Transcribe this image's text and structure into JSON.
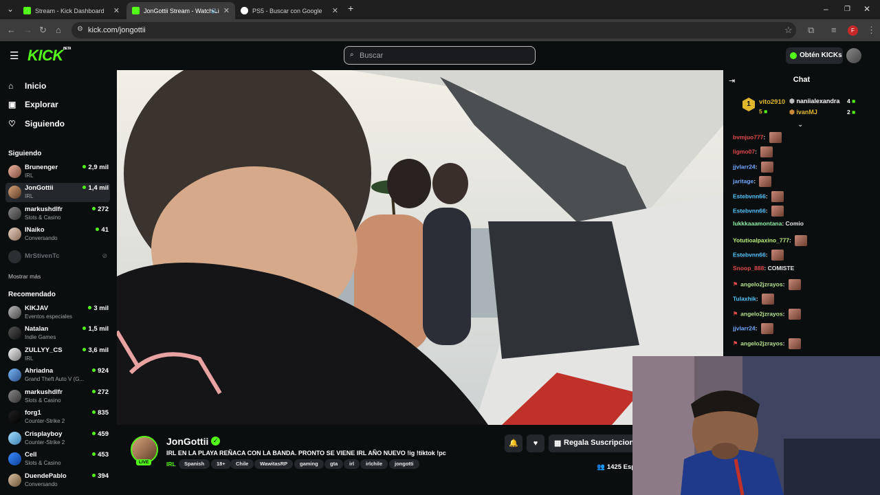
{
  "browser": {
    "tabs": [
      {
        "label": "Stream - Kick Dashboard",
        "active": false
      },
      {
        "label": "JonGottii Stream - Watch Li",
        "active": true
      },
      {
        "label": "PS5 - Buscar con Google",
        "active": false
      }
    ],
    "url": "kick.com/jongottii",
    "profile_initial": "F"
  },
  "header": {
    "logo": "KICK",
    "logo_sup": "BETA",
    "search_placeholder": "Buscar",
    "obten_label": "Obtén KICKs"
  },
  "sidebar": {
    "nav": [
      {
        "label": "Inicio",
        "icon": "home-icon"
      },
      {
        "label": "Explorar",
        "icon": "compass-icon"
      },
      {
        "label": "Siguiendo",
        "icon": "heart-icon"
      }
    ],
    "following_title": "Siguiendo",
    "following": [
      {
        "name": "Brunenger",
        "category": "IRL",
        "viewers": "2,9 mil"
      },
      {
        "name": "JonGottii",
        "category": "IRL",
        "viewers": "1,4 mil"
      },
      {
        "name": "markushdlfr",
        "category": "Slots & Casino",
        "viewers": "272"
      },
      {
        "name": "INaiko",
        "category": "Conversando",
        "viewers": "41"
      },
      {
        "name": "MrStivenTc",
        "category": "",
        "viewers": ""
      }
    ],
    "show_more": "Mostrar más",
    "recommended_title": "Recomendado",
    "recommended": [
      {
        "name": "KIKJAV",
        "category": "Eventos especiales",
        "viewers": "3 mil"
      },
      {
        "name": "Natalan",
        "category": "Indie Games",
        "viewers": "1,5 mil"
      },
      {
        "name": "ZULLYY_CS",
        "category": "IRL",
        "viewers": "3,6 mil"
      },
      {
        "name": "Ahriadna",
        "category": "Grand Theft Auto V (G...",
        "viewers": "924"
      },
      {
        "name": "markushdlfr",
        "category": "Slots & Casino",
        "viewers": "272"
      },
      {
        "name": "forg1",
        "category": "Counter-Strike 2",
        "viewers": "835"
      },
      {
        "name": "Crisplayboy",
        "category": "Counter-Strike 2",
        "viewers": "459"
      },
      {
        "name": "Cell",
        "category": "Slots & Casino",
        "viewers": "453"
      },
      {
        "name": "DuendePablo",
        "category": "Conversando",
        "viewers": "394"
      }
    ]
  },
  "stream": {
    "channel": "JonGottii",
    "live_label": "LIVE",
    "title": "IRL EN LA PLAYA REÑACA CON LA BANDA. PRONTO SE VIENE IRL AÑO NUEVO !ig !tiktok !pc",
    "category": "IRL",
    "tags": [
      "Spanish",
      "18+",
      "Chile",
      "WawitasRP",
      "gaming",
      "gta",
      "irl",
      "irlchile",
      "jongotti"
    ],
    "gift_label": "Regala Suscripcione",
    "viewers": "1425 Esp"
  },
  "chat": {
    "title": "Chat",
    "gifters": [
      {
        "name": "vito2910",
        "count": "5",
        "rank": "1"
      },
      {
        "name": "naniialexandra",
        "count": "4"
      },
      {
        "name": "ivanMJ",
        "count": "2"
      }
    ],
    "messages": [
      {
        "user": "bvmjuo777",
        "text": "",
        "color": "#e24a4a",
        "emote": true
      },
      {
        "user": "ligmo07",
        "text": "",
        "color": "#e24a4a",
        "emote": true
      },
      {
        "user": "jjvlarr24",
        "text": "",
        "color": "#6ea8ff",
        "emote": true
      },
      {
        "user": "jaritage",
        "text": "",
        "color": "#6ea8ff",
        "emote": true
      },
      {
        "user": "Estebvnn66",
        "text": "",
        "color": "#53c7ff",
        "emote": true
      },
      {
        "user": "Estebvnn66",
        "text": "",
        "color": "#53c7ff",
        "emote": true
      },
      {
        "user": "lukkkaaamontana",
        "text": "Comio",
        "color": "#8ff0a4",
        "emote": false
      },
      {
        "user": "Yotutioalpaxino_777",
        "text": "",
        "color": "#b7f07a",
        "emote": true
      },
      {
        "user": "Estebvnn66",
        "text": "",
        "color": "#53c7ff",
        "emote": true
      },
      {
        "user": "Snoop_888",
        "text": "COMISTE",
        "color": "#e24a4a",
        "emote": false
      },
      {
        "user": "angelo2jzrayos",
        "text": "",
        "color": "#b6e08a",
        "emote": true,
        "badge": true
      },
      {
        "user": "Tulaxhik",
        "text": "",
        "color": "#53c7ff",
        "emote": true
      },
      {
        "user": "angelo2jzrayos",
        "text": "",
        "color": "#b6e08a",
        "emote": true,
        "badge": true
      },
      {
        "user": "jjvlarr24",
        "text": "",
        "color": "#6ea8ff",
        "emote": true
      },
      {
        "user": "angelo2jzrayos",
        "text": "",
        "color": "#b6e08a",
        "emote": true,
        "badge": true
      }
    ]
  }
}
